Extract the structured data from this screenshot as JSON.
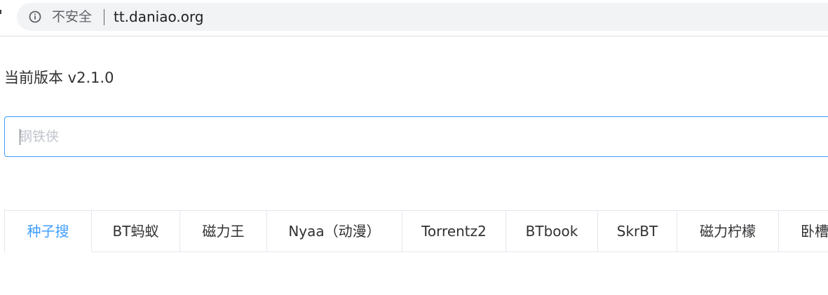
{
  "browser": {
    "security_label": "不安全",
    "url": "tt.daniao.org",
    "info_icon": "info-icon"
  },
  "page": {
    "version_text": "当前版本 v2.1.0"
  },
  "search": {
    "placeholder": "钢铁侠",
    "value": ""
  },
  "tabs": [
    {
      "label": "种子搜"
    },
    {
      "label": "BT蚂蚁"
    },
    {
      "label": "磁力王"
    },
    {
      "label": "Nyaa（动漫）"
    },
    {
      "label": "Torrentz2"
    },
    {
      "label": "BTbook"
    },
    {
      "label": "SkrBT"
    },
    {
      "label": "磁力柠檬"
    },
    {
      "label": "卧槽"
    }
  ],
  "colors": {
    "accent": "#409eff",
    "border": "#e4e7ed",
    "text": "#303133",
    "placeholder": "#c0c4cc"
  }
}
